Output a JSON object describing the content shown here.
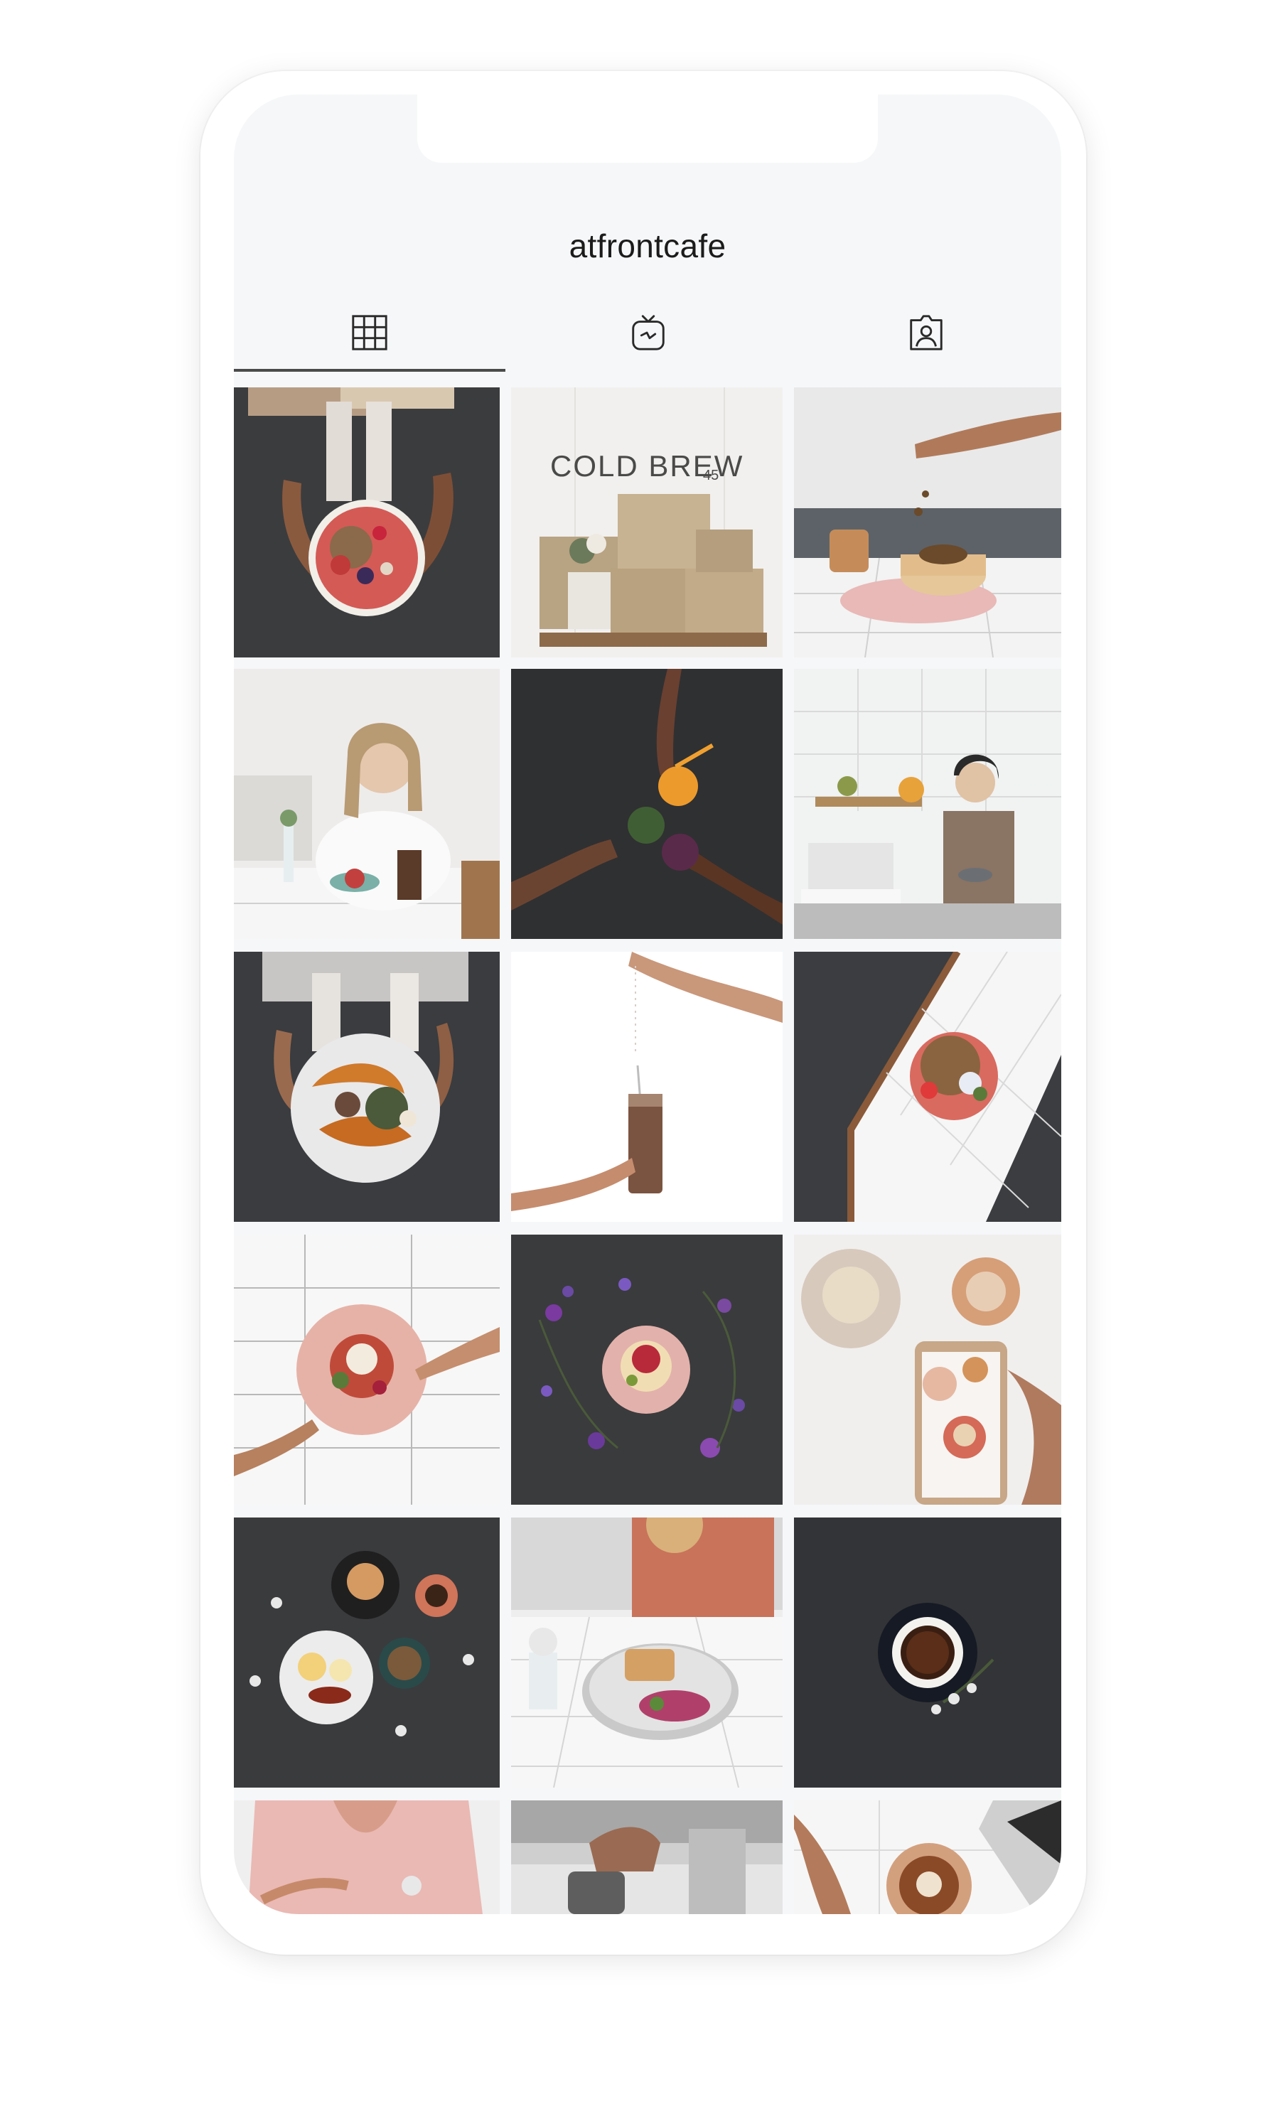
{
  "profile": {
    "username": "atfrontcafe"
  },
  "tabs": [
    {
      "icon": "grid-icon",
      "active": true
    },
    {
      "icon": "igtv-icon",
      "active": false
    },
    {
      "icon": "tagged-person-icon",
      "active": false
    }
  ],
  "posts": [
    {
      "desc": "acai-bowl-held-over-floor"
    },
    {
      "desc": "cold-brew-shelf"
    },
    {
      "desc": "pancakes-with-sprinkle"
    },
    {
      "desc": "woman-eating-at-table"
    },
    {
      "desc": "three-smoothies-cheers"
    },
    {
      "desc": "barista-with-cup"
    },
    {
      "desc": "pumpkin-salad-plate"
    },
    {
      "desc": "chocolate-smoothie-white"
    },
    {
      "desc": "smoothie-bowl-tiles-diagonal"
    },
    {
      "desc": "pink-plate-on-tiles"
    },
    {
      "desc": "pink-plate-with-flowers"
    },
    {
      "desc": "phone-photo-of-food"
    },
    {
      "desc": "breakfast-spread-dark"
    },
    {
      "desc": "salad-and-tart-plate"
    },
    {
      "desc": "coffee-cup-dark"
    },
    {
      "desc": "woman-pink-shirt"
    },
    {
      "desc": "pour-over-coffee"
    },
    {
      "desc": "latte-art-laptop"
    }
  ],
  "sign": {
    "text": "COLD BREW",
    "number": "45"
  },
  "colors": {
    "screen_bg": "#f6f7f9",
    "tab_indicator": "#4a4a4a",
    "icon": "#2a2a2a"
  }
}
